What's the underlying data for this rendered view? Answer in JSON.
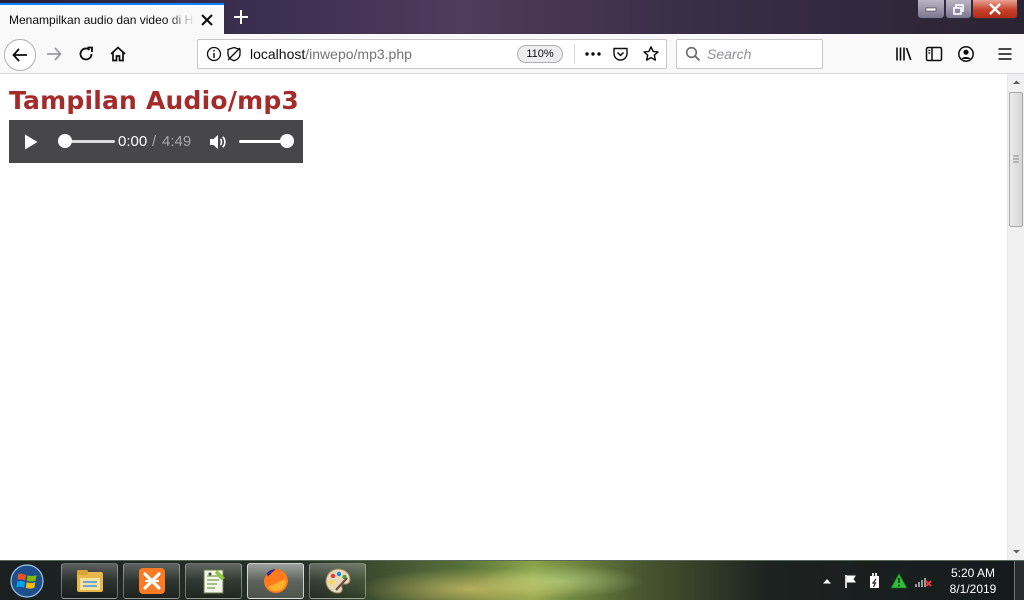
{
  "browser": {
    "tab": {
      "title": "Menampilkan audio dan video di HTML"
    },
    "url": {
      "host": "localhost",
      "path": "/inwepo/mp3.php"
    },
    "zoom": "110%",
    "search": {
      "placeholder": "Search"
    }
  },
  "page": {
    "heading": "Tampilan Audio/mp3",
    "heading_color": "#a52a2a",
    "audio": {
      "current_time": "0:00",
      "separator": "/",
      "duration": "4:49",
      "progress": 0.0,
      "volume": 1.0
    }
  },
  "taskbar": {
    "apps": [
      "file-explorer-icon",
      "xampp-icon",
      "notepad-plus-plus-icon",
      "firefox-icon",
      "paint-icon"
    ],
    "clock": {
      "time": "5:20 AM",
      "date": "8/1/2019"
    }
  },
  "colors": {
    "accent": "#0a84ff",
    "player_background": "#474749"
  }
}
